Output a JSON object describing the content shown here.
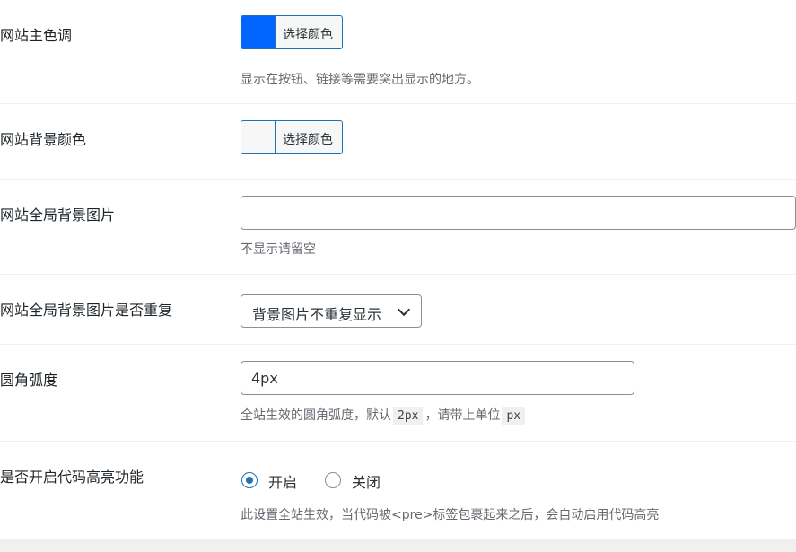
{
  "settings": {
    "primary_color": {
      "label": "网站主色调",
      "button_text": "选择颜色",
      "swatch_color": "#0066ff",
      "description": "显示在按钮、链接等需要突出显示的地方。"
    },
    "background_color": {
      "label": "网站背景颜色",
      "button_text": "选择颜色",
      "swatch_color": "#f7f7f8"
    },
    "background_image": {
      "label": "网站全局背景图片",
      "value": "",
      "description": "不显示请留空"
    },
    "background_repeat": {
      "label": "网站全局背景图片是否重复",
      "selected": "背景图片不重复显示"
    },
    "border_radius": {
      "label": "圆角弧度",
      "value": "4px",
      "desc_prefix": "全站生效的圆角弧度，默认",
      "default_code": "2px",
      "desc_middle": "，请带上单位",
      "unit_code": "px"
    },
    "code_highlight": {
      "label": "是否开启代码高亮功能",
      "options": [
        "开启",
        "关闭"
      ],
      "selected": "开启",
      "description": "此设置全站生效，当代码被<pre>标签包裹起来之后，会自动启用代码高亮"
    }
  },
  "colors": {
    "accent": "#2271b1",
    "border": "#8c8f94"
  }
}
